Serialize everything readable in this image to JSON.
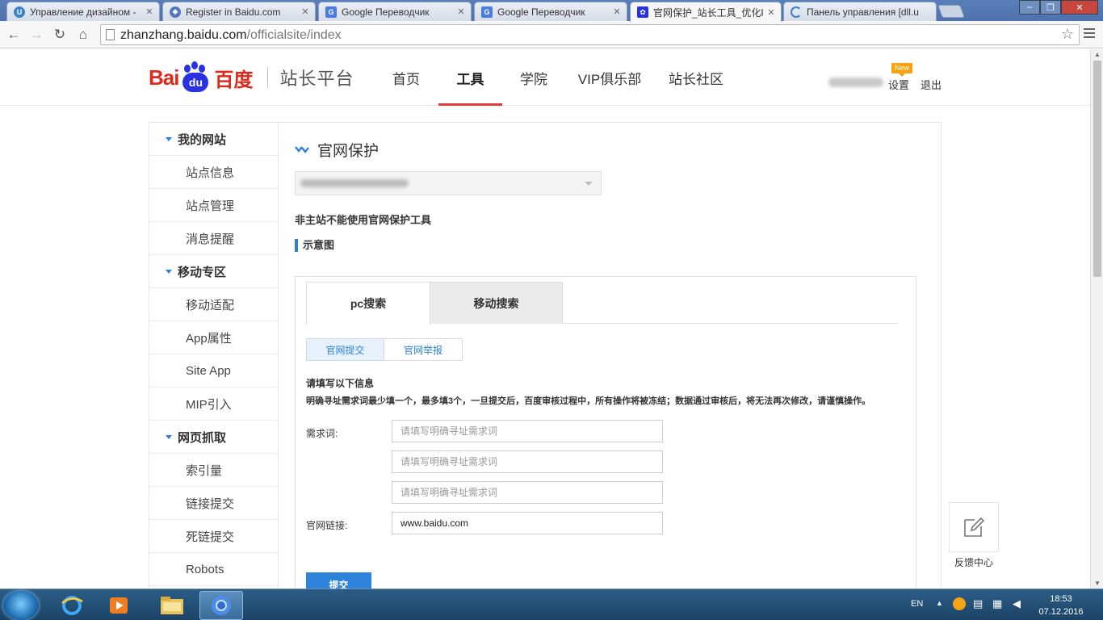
{
  "browser": {
    "tabs": [
      {
        "title": "Управление дизайном - "
      },
      {
        "title": "Register in Baidu.com"
      },
      {
        "title": "Google Переводчик"
      },
      {
        "title": "Google Переводчик"
      },
      {
        "title": "官网保护_站长工具_优化P"
      },
      {
        "title": "Панель управления [dll.u"
      }
    ],
    "url_host": "zhanzhang.baidu.com",
    "url_path": "/officialsite/index"
  },
  "header": {
    "logo_bai": "Bai",
    "logo_du": "du",
    "logo_cn": "百度",
    "platform": "站长平台",
    "nav": [
      "首页",
      "工具",
      "学院",
      "VIP俱乐部",
      "站长社区"
    ],
    "badge": "New",
    "settings": "设置",
    "logout": "退出"
  },
  "sidebar": [
    {
      "type": "group",
      "label": "我的网站"
    },
    {
      "type": "item",
      "label": "站点信息"
    },
    {
      "type": "item",
      "label": "站点管理"
    },
    {
      "type": "item",
      "label": "消息提醒"
    },
    {
      "type": "group",
      "label": "移动专区"
    },
    {
      "type": "item",
      "label": "移动适配"
    },
    {
      "type": "item",
      "label": "App属性"
    },
    {
      "type": "item",
      "label": "Site App"
    },
    {
      "type": "item",
      "label": "MIP引入"
    },
    {
      "type": "group",
      "label": "网页抓取"
    },
    {
      "type": "item",
      "label": "索引量"
    },
    {
      "type": "item",
      "label": "链接提交"
    },
    {
      "type": "item",
      "label": "死链提交"
    },
    {
      "type": "item",
      "label": "Robots"
    }
  ],
  "main": {
    "title": "官网保护",
    "warning": "非主站不能使用官网保护工具",
    "subhead": "示意图",
    "tabs": [
      "pc搜索",
      "移动搜索"
    ],
    "subtabs": [
      "官网提交",
      "官网举报"
    ],
    "form_heading": "请填写以下信息",
    "form_note": "明确寻址需求词最少填一个，最多填3个，一旦提交后，百度审核过程中，所有操作将被冻结；数据通过审核后，将无法再次修改，请谨慎操作。",
    "keyword_label": "需求词:",
    "keyword_placeholder": "请填写明确寻址需求词",
    "link_label": "官网链接:",
    "link_value": "www.baidu.com",
    "submit": "提交"
  },
  "feedback": "反馈中心",
  "taskbar": {
    "lang": "EN",
    "time": "18:53",
    "date": "07.12.2016"
  },
  "colors": {
    "accent_blue": "#2e82d9",
    "nav_red": "#e4393c",
    "baidu_red": "#de2a1e",
    "baidu_blue": "#2932e1"
  }
}
